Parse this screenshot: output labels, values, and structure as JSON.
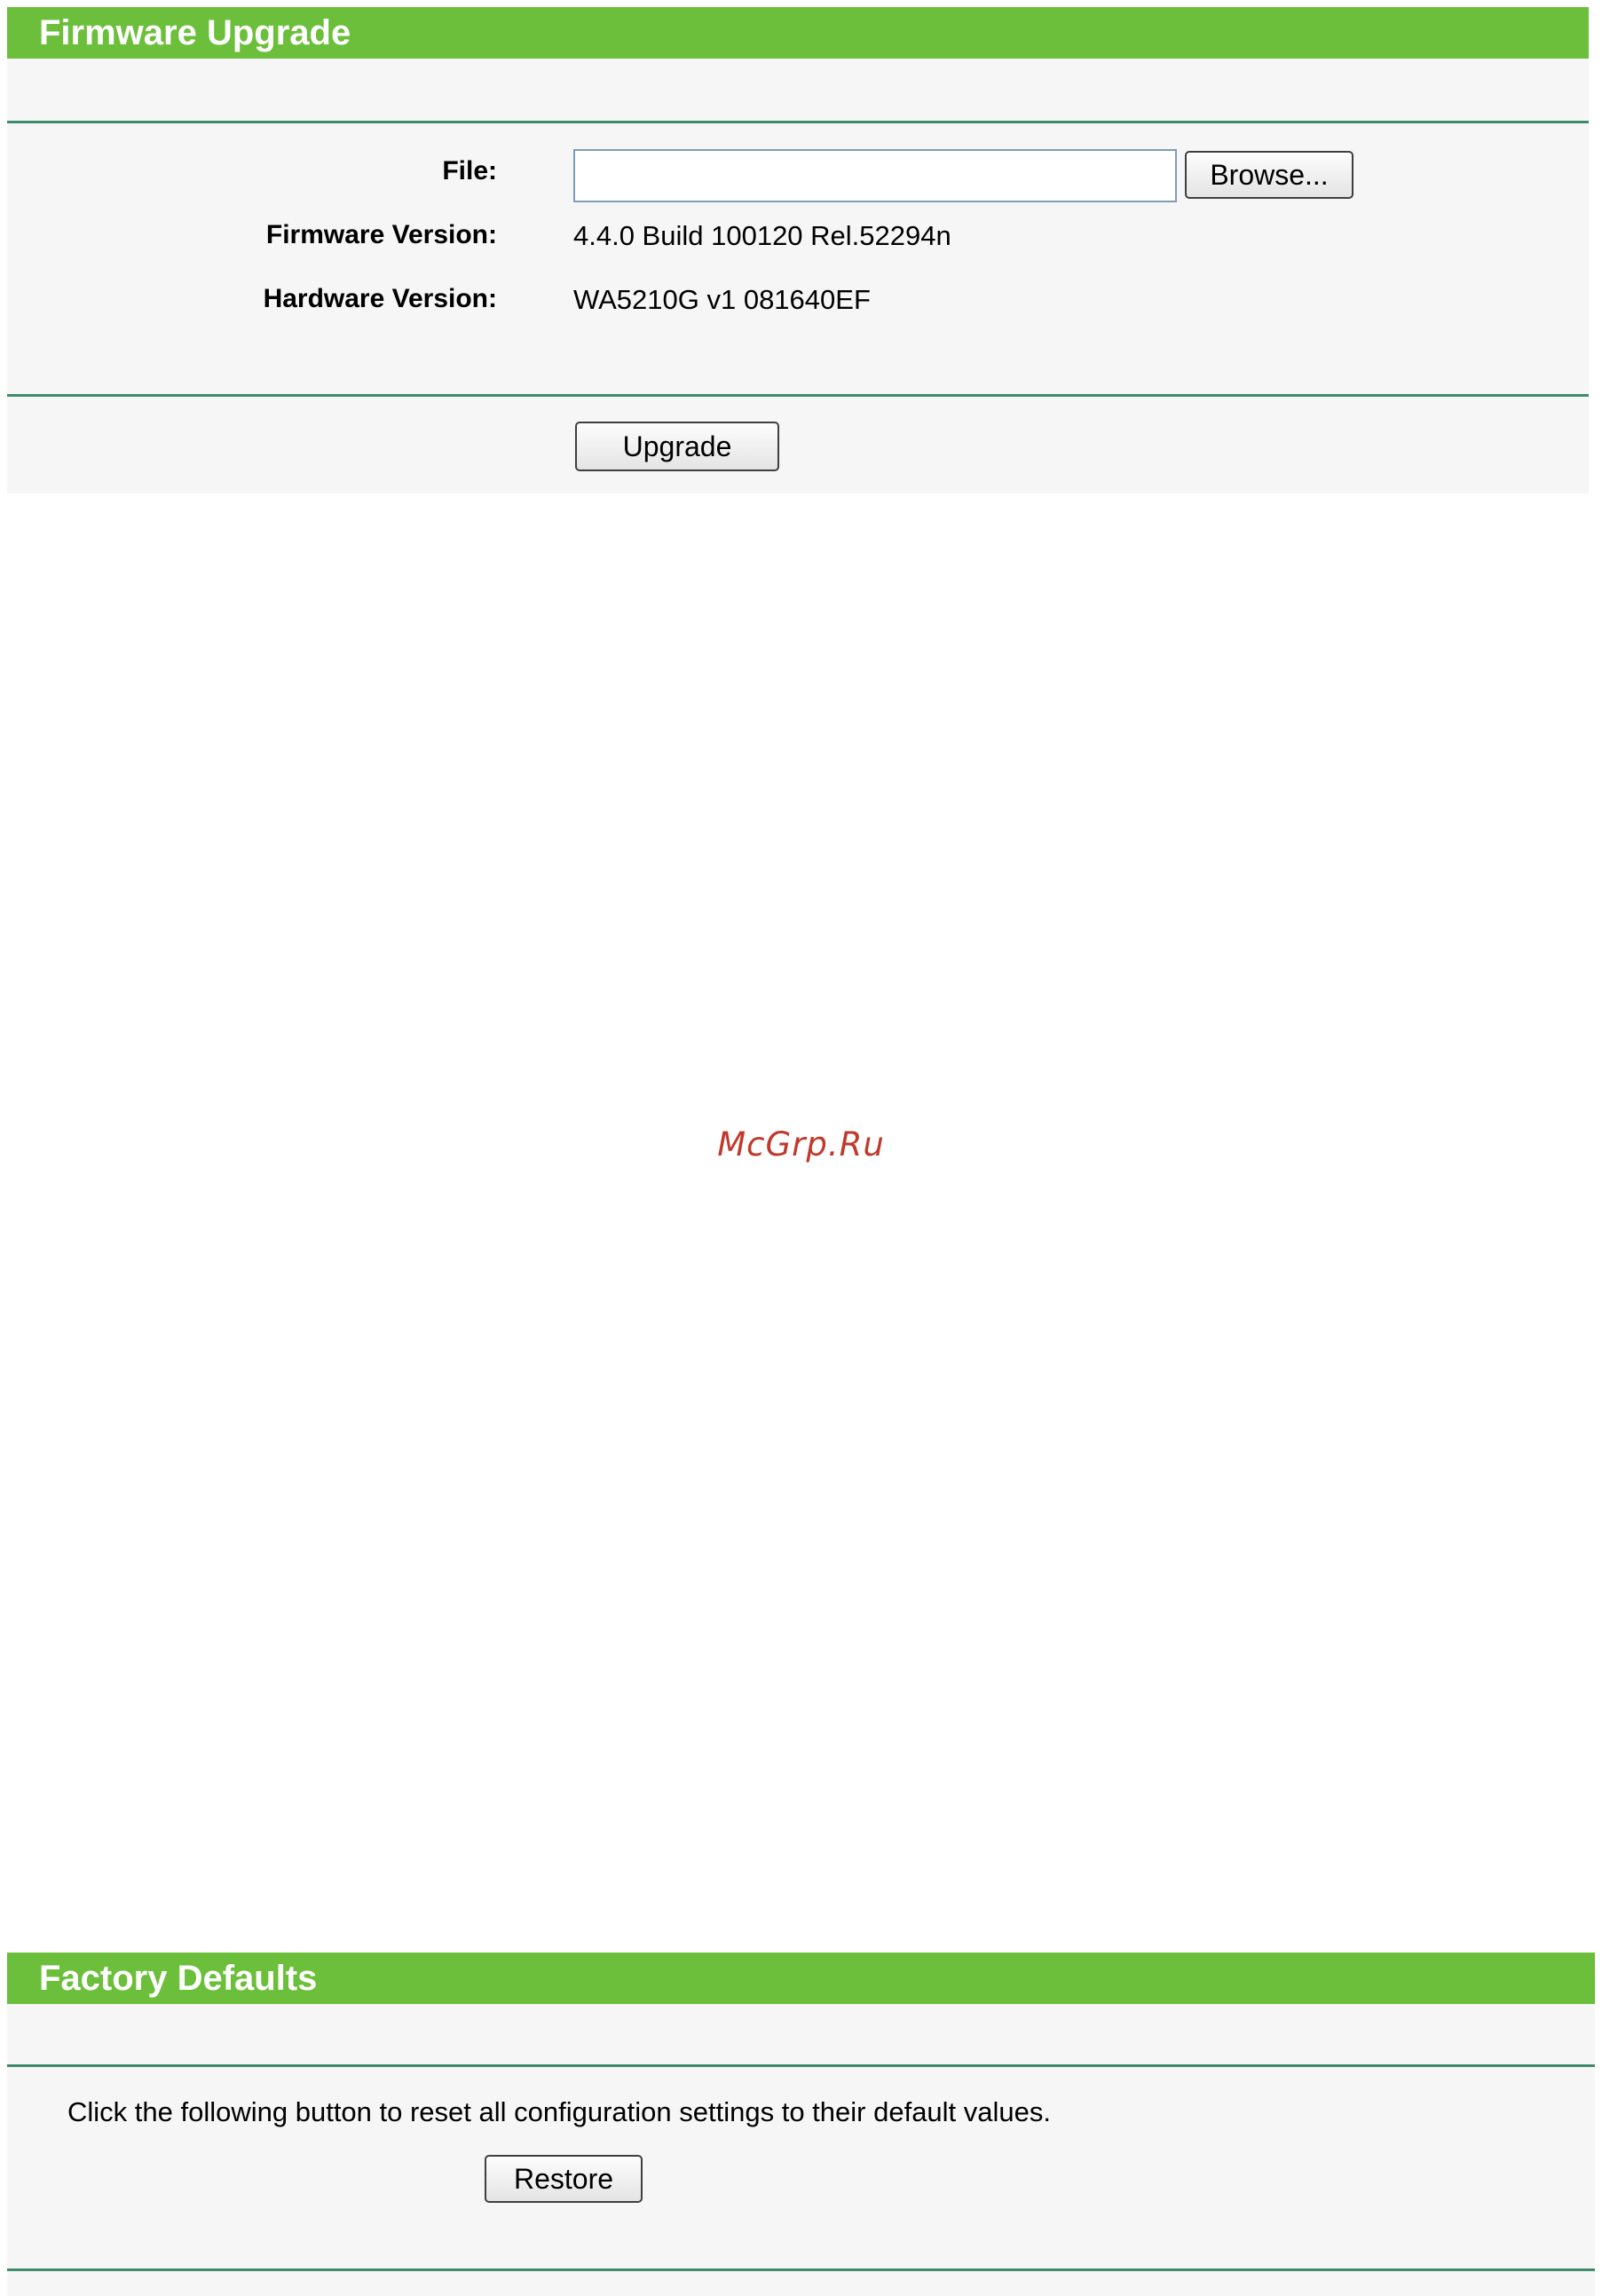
{
  "firmware_upgrade": {
    "title": "Firmware Upgrade",
    "file_label": "File:",
    "file_value": "",
    "browse_label": "Browse...",
    "firmware_version_label": "Firmware Version:",
    "firmware_version_value": "4.4.0 Build 100120 Rel.52294n",
    "hardware_version_label": "Hardware Version:",
    "hardware_version_value": "WA5210G v1 081640EF",
    "upgrade_label": "Upgrade"
  },
  "watermark": {
    "text": "McGrp.Ru"
  },
  "factory_defaults": {
    "title": "Factory Defaults",
    "description": "Click the following button to reset all configuration settings to their default values.",
    "restore_label": "Restore"
  },
  "colors": {
    "header_green": "#6bbf3a",
    "rule_green": "#3e8c6a",
    "panel_bg": "#f6f6f6"
  }
}
